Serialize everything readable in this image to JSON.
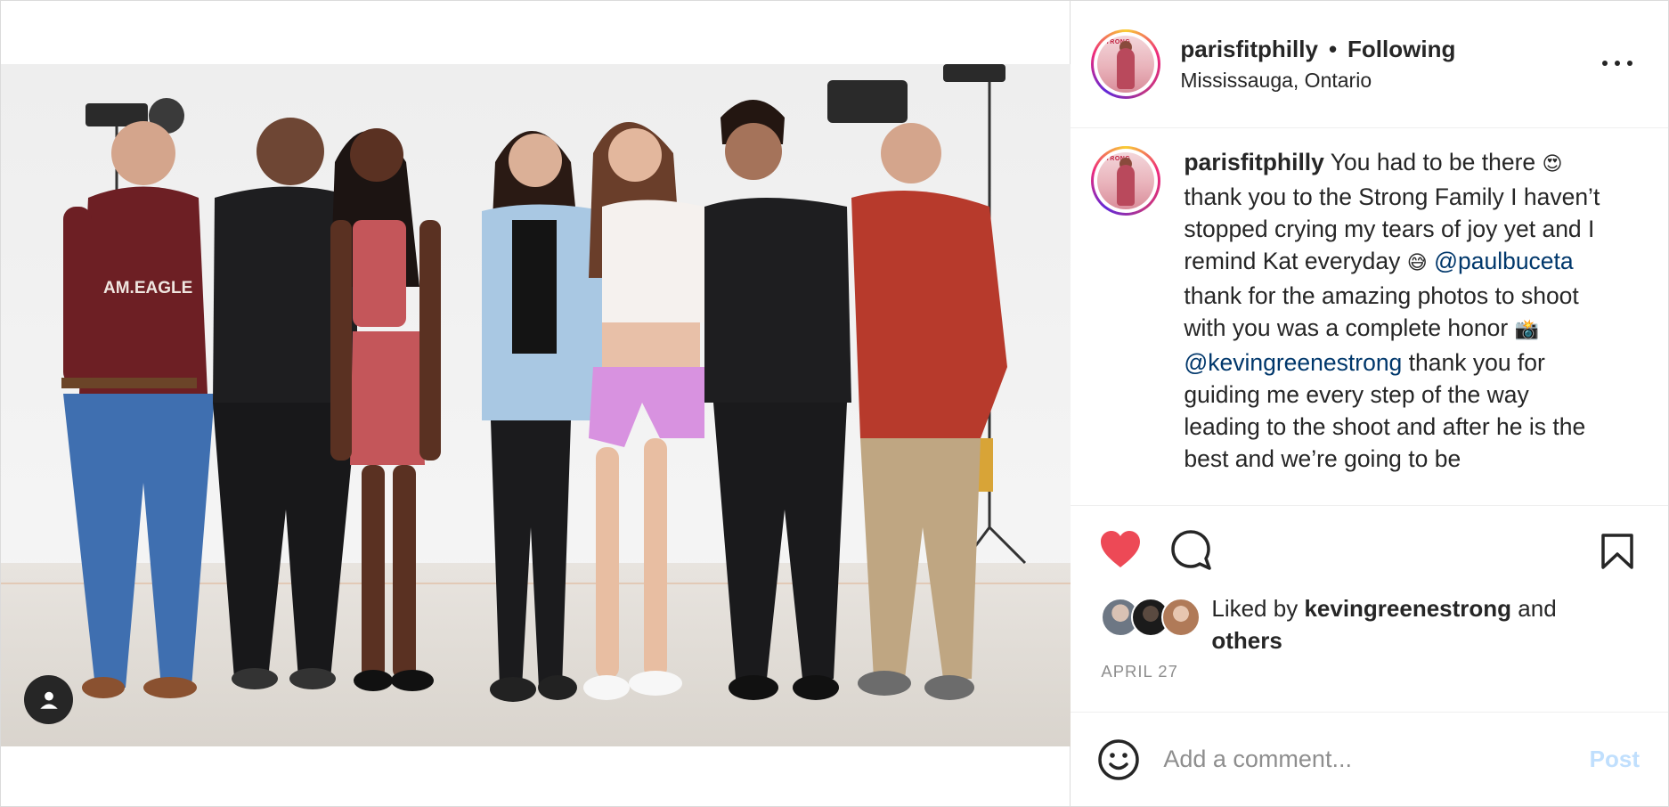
{
  "post": {
    "author": "parisfitphilly",
    "separator": "•",
    "follow_state": "Following",
    "location": "Mississauga, Ontario",
    "avatar": {
      "magazine_title": "STRONG",
      "magazine_name": "NOEL GRIFFIN"
    }
  },
  "photo": {
    "shirt_text": "AM.EAGLE"
  },
  "caption": {
    "username": "parisfitphilly",
    "part1": " You had to be there ",
    "emoji1": "😍",
    "part2": " thank you to the Strong Family I haven’t stopped crying my tears of joy yet and I remind Kat everyday ",
    "emoji2": "😅",
    "mention1": "@paulbuceta",
    "part3": " thank for the amazing photos to shoot with you was a complete honor ",
    "emoji3": "📸",
    "mention2": "@kevingreenestrong",
    "part4": " thank you for guiding me every step of the way leading to the shoot and after he is the best and we’re going to be"
  },
  "likes": {
    "prefix": "Liked by ",
    "user": "kevingreenestrong",
    "middle": " and",
    "others": "others"
  },
  "date": "APRIL 27",
  "comment_box": {
    "placeholder": "Add a comment...",
    "post_label": "Post"
  },
  "colors": {
    "like_red": "#ed4956",
    "mention_blue": "#00376b",
    "post_disabled": "#c0dffd",
    "muted": "#8e8e8e"
  },
  "icons": [
    "user-tag-icon",
    "more-options-icon",
    "heart-icon",
    "comment-icon",
    "bookmark-icon",
    "smile-icon"
  ]
}
